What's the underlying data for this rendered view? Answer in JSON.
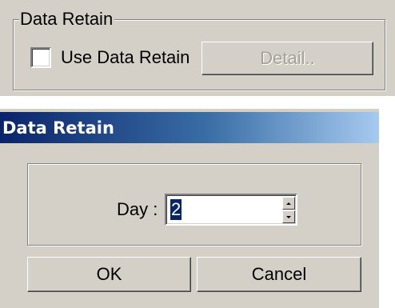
{
  "retain_panel": {
    "group_title": "Data Retain",
    "checkbox_label": "Use Data Retain",
    "checkbox_checked": false,
    "detail_button_label": "Detail..",
    "detail_button_enabled": false
  },
  "dialog": {
    "title": "Data Retain",
    "day_label": "Day :",
    "day_value": "2",
    "ok_label": "OK",
    "cancel_label": "Cancel"
  },
  "colors": {
    "face": "#d4d0c8",
    "titlebar_start": "#0a246a",
    "titlebar_end": "#a6caf0",
    "selection": "#0a246a"
  },
  "icons": {
    "spin_up": "spin-up-arrow-icon",
    "spin_down": "spin-down-arrow-icon"
  }
}
